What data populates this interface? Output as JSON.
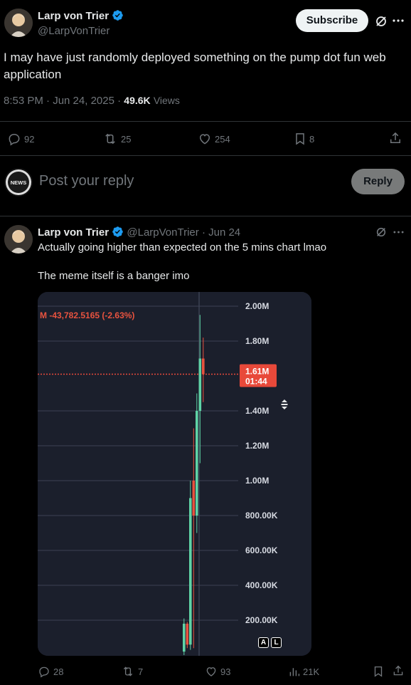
{
  "post": {
    "author_name": "Larp von Trier",
    "author_handle": "@LarpVonTrier",
    "subscribe_label": "Subscribe",
    "text": "I may have just randomly deployed something on the pump dot fun web application",
    "time": "8:53 PM · Jun 24, 2025 ·",
    "views_count": "49.6K",
    "views_label": "Views",
    "replies": "92",
    "reposts": "25",
    "likes": "254",
    "bookmarks": "8"
  },
  "compose": {
    "avatar_text": "NEWS",
    "placeholder": "Post your reply",
    "reply_label": "Reply"
  },
  "reply": {
    "author_name": "Larp von Trier",
    "author_handle": "@LarpVonTrier",
    "date": "· Jun 24",
    "line1": "Actually going higher than expected on the 5 mins chart lmao",
    "line2": "The meme itself is a banger imo",
    "replies": "28",
    "reposts": "7",
    "likes": "93",
    "views": "21K"
  },
  "chart_data": {
    "type": "candlestick",
    "header_change": "M -43,782.5165 (-2.63%)",
    "y_tick_labels": [
      "2.00M",
      "1.80M",
      "1.40M",
      "1.20M",
      "1.00M",
      "800.00K",
      "600.00K",
      "400.00K",
      "200.00K"
    ],
    "y_ticks": [
      2000000,
      1800000,
      1400000,
      1200000,
      1000000,
      800000,
      600000,
      400000,
      200000
    ],
    "ylim": [
      0,
      2000000
    ],
    "current_price_label": "1.61M",
    "current_price": 1610000,
    "countdown": "01:44",
    "buttons": [
      "A",
      "L"
    ],
    "colors": {
      "up": "#5fd3a6",
      "down": "#e8533f",
      "price_tag": "#e8493a"
    },
    "candles": [
      {
        "o": 20000,
        "c": 180000,
        "h": 210000,
        "l": 0
      },
      {
        "o": 180000,
        "c": 60000,
        "h": 190000,
        "l": 40000
      },
      {
        "o": 60000,
        "c": 900000,
        "h": 1000000,
        "l": 30000
      },
      {
        "o": 1000000,
        "c": 800000,
        "h": 1300000,
        "l": 40000
      },
      {
        "o": 800000,
        "c": 1400000,
        "h": 1500000,
        "l": 700000
      },
      {
        "o": 1400000,
        "c": 1700000,
        "h": 1950000,
        "l": 1100000
      },
      {
        "o": 1700000,
        "c": 1610000,
        "h": 1820000,
        "l": 1450000
      }
    ]
  }
}
